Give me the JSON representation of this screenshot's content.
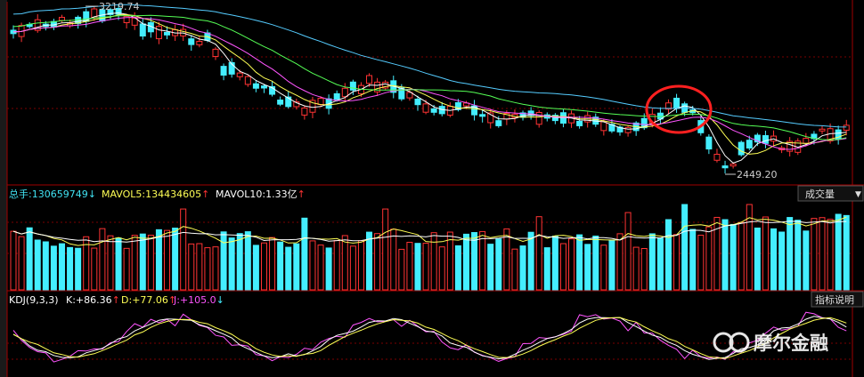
{
  "chart_data": [
    {
      "type": "candlestick",
      "name": "price-panel",
      "annotations": [
        {
          "label": "3219.74",
          "value": 3219.74,
          "kind": "high"
        },
        {
          "label": "2449.20",
          "value": 2449.2,
          "kind": "low"
        }
      ],
      "series": [
        {
          "name": "MA5",
          "color": "#ffffff"
        },
        {
          "name": "MA10",
          "color": "#ffff55"
        },
        {
          "name": "MA20",
          "color": "#ff55ff"
        },
        {
          "name": "MA30",
          "color": "#55ff55"
        },
        {
          "name": "MA60",
          "color": "#55ccff"
        }
      ],
      "highlight": {
        "shape": "circle",
        "color": "#ff2222"
      }
    },
    {
      "type": "bar",
      "name": "volume-panel",
      "title": "成交量",
      "legend": [
        {
          "label": "总手:",
          "value": "130659749",
          "arrow": "↓",
          "color": "#41e3f3"
        },
        {
          "label": "MAVOL5:",
          "value": "134434605",
          "arrow": "↑",
          "color": "#ffff55"
        },
        {
          "label": "MAVOL10:",
          "value": "1.33亿",
          "arrow": "↑",
          "color": "#ffffff"
        }
      ]
    },
    {
      "type": "line",
      "name": "kdj-panel",
      "title": "指标说明",
      "legend": [
        {
          "label": "KDJ(9,3,3)",
          "value": "",
          "arrow": "",
          "color": "#ffffff"
        },
        {
          "label": "K:",
          "value": "+86.36",
          "arrow": "↑",
          "color": "#ffffff"
        },
        {
          "label": "D:",
          "value": "+77.06",
          "arrow": "↑",
          "color": "#ffff55"
        },
        {
          "label": "J:",
          "value": "+105.0",
          "arrow": "↓",
          "color": "#ff55ff"
        }
      ]
    }
  ],
  "watermark": {
    "text": "摩尔金融"
  },
  "colors": {
    "up": "#ff3333",
    "down": "#44eeff",
    "grid": "#8b0000",
    "bg": "#000000"
  }
}
